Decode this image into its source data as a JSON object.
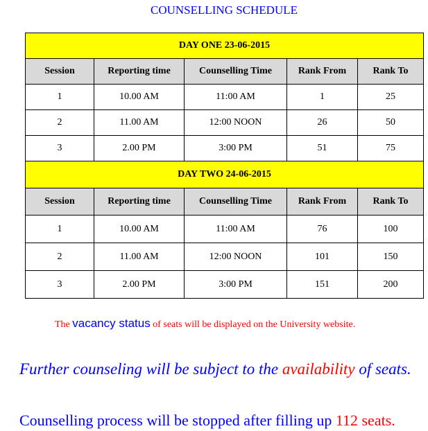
{
  "title": "COUNSELLING SCHEDULE",
  "columns": [
    "Session",
    "Reporting time",
    "Counselling Time",
    "Rank From",
    "Rank To"
  ],
  "days": [
    {
      "label": "DAY ONE 23-06-2015",
      "rows": [
        {
          "session": "1",
          "reporting_time": "10.00 AM",
          "counselling_time": "11:00 AM",
          "rank_from": "1",
          "rank_to": "25"
        },
        {
          "session": "2",
          "reporting_time": "11.00 AM",
          "counselling_time": "12:00 NOON",
          "rank_from": "26",
          "rank_to": "50"
        },
        {
          "session": "3",
          "reporting_time": "2.00 PM",
          "counselling_time": "3:00 PM",
          "rank_from": "51",
          "rank_to": "75"
        }
      ]
    },
    {
      "label": "DAY TWO 24-06-2015",
      "rows": [
        {
          "session": "1",
          "reporting_time": "10.00 AM",
          "counselling_time": "11:00 AM",
          "rank_from": "76",
          "rank_to": "100"
        },
        {
          "session": "2",
          "reporting_time": "11.00 AM",
          "counselling_time": "12:00 NOON",
          "rank_from": "101",
          "rank_to": "150"
        },
        {
          "session": "3",
          "reporting_time": "2.00 PM",
          "counselling_time": "3:00 PM",
          "rank_from": "151",
          "rank_to": "200"
        }
      ]
    }
  ],
  "notes": {
    "vacancy": {
      "prefix": "The ",
      "highlight": "vacancy status",
      "suffix": " of seats will be displayed on the University website."
    },
    "further": {
      "prefix": "Further counseling will be subject to the ",
      "highlight": "availability",
      "suffix": " of seats."
    },
    "stop": {
      "prefix": "Counselling process will be stopped after filling up ",
      "highlight": "112 seats."
    }
  },
  "colors": {
    "title": "#0000ff",
    "day_band": "#ffff00",
    "header_band": "#d9d9d9",
    "note_red": "#ff0000",
    "note_blue": "#0000ff"
  }
}
